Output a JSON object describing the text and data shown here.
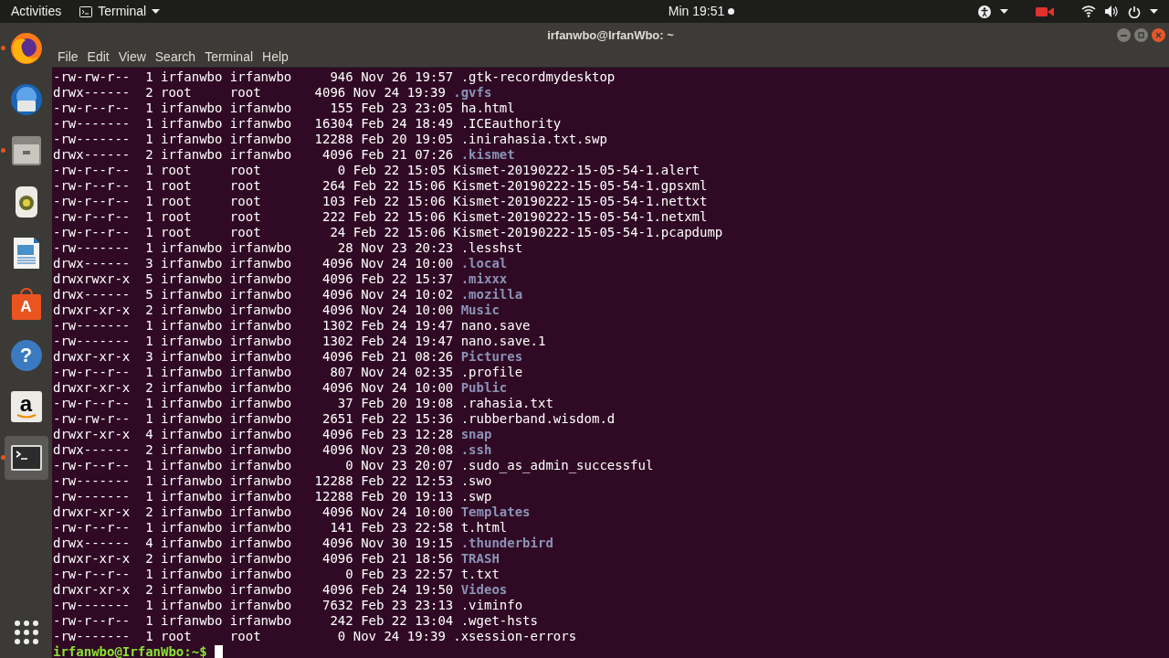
{
  "top_bar": {
    "activities": "Activities",
    "app_menu": "Terminal",
    "clock": "Min 19:51"
  },
  "dock": [
    {
      "kind": "firefox",
      "running": true,
      "selected": false
    },
    {
      "kind": "mail",
      "running": false,
      "selected": false
    },
    {
      "kind": "files",
      "running": true,
      "selected": false
    },
    {
      "kind": "speaker",
      "running": false,
      "selected": false
    },
    {
      "kind": "document",
      "running": false,
      "selected": false
    },
    {
      "kind": "software",
      "glyph": "A",
      "running": false,
      "selected": false
    },
    {
      "kind": "help",
      "glyph": "?",
      "running": false,
      "selected": false
    },
    {
      "kind": "amazon",
      "glyph": "a",
      "running": false,
      "selected": false
    },
    {
      "kind": "terminal",
      "running": true,
      "selected": true
    }
  ],
  "window": {
    "title": "irfanwbo@IrfanWbo: ~",
    "menu": [
      "File",
      "Edit",
      "View",
      "Search",
      "Terminal",
      "Help"
    ]
  },
  "terminal": {
    "rows": [
      {
        "listing": "-rw-rw-r--  1 irfanwbo irfanwbo     946 Nov 26 19:57",
        "name": ".gtk-recordmydesktop",
        "kind": "file"
      },
      {
        "listing": "drwx------  2 root     root       4096 Nov 24 19:39",
        "name": ".gvfs",
        "kind": "dir"
      },
      {
        "listing": "-rw-r--r--  1 irfanwbo irfanwbo     155 Feb 23 23:05",
        "name": "ha.html",
        "kind": "file"
      },
      {
        "listing": "-rw-------  1 irfanwbo irfanwbo   16304 Feb 24 18:49",
        "name": ".ICEauthority",
        "kind": "file"
      },
      {
        "listing": "-rw-------  1 irfanwbo irfanwbo   12288 Feb 20 19:05",
        "name": ".inirahasia.txt.swp",
        "kind": "file"
      },
      {
        "listing": "drwx------  2 irfanwbo irfanwbo    4096 Feb 21 07:26",
        "name": ".kismet",
        "kind": "dir"
      },
      {
        "listing": "-rw-r--r--  1 root     root          0 Feb 22 15:05",
        "name": "Kismet-20190222-15-05-54-1.alert",
        "kind": "file"
      },
      {
        "listing": "-rw-r--r--  1 root     root        264 Feb 22 15:06",
        "name": "Kismet-20190222-15-05-54-1.gpsxml",
        "kind": "file"
      },
      {
        "listing": "-rw-r--r--  1 root     root        103 Feb 22 15:06",
        "name": "Kismet-20190222-15-05-54-1.nettxt",
        "kind": "file"
      },
      {
        "listing": "-rw-r--r--  1 root     root        222 Feb 22 15:06",
        "name": "Kismet-20190222-15-05-54-1.netxml",
        "kind": "file"
      },
      {
        "listing": "-rw-r--r--  1 root     root         24 Feb 22 15:06",
        "name": "Kismet-20190222-15-05-54-1.pcapdump",
        "kind": "file"
      },
      {
        "listing": "-rw-------  1 irfanwbo irfanwbo      28 Nov 23 20:23",
        "name": ".lesshst",
        "kind": "file"
      },
      {
        "listing": "drwx------  3 irfanwbo irfanwbo    4096 Nov 24 10:00",
        "name": ".local",
        "kind": "dir"
      },
      {
        "listing": "drwxrwxr-x  5 irfanwbo irfanwbo    4096 Feb 22 15:37",
        "name": ".mixxx",
        "kind": "dir"
      },
      {
        "listing": "drwx------  5 irfanwbo irfanwbo    4096 Nov 24 10:02",
        "name": ".mozilla",
        "kind": "dir"
      },
      {
        "listing": "drwxr-xr-x  2 irfanwbo irfanwbo    4096 Nov 24 10:00",
        "name": "Music",
        "kind": "dir"
      },
      {
        "listing": "-rw-------  1 irfanwbo irfanwbo    1302 Feb 24 19:47",
        "name": "nano.save",
        "kind": "file"
      },
      {
        "listing": "-rw-------  1 irfanwbo irfanwbo    1302 Feb 24 19:47",
        "name": "nano.save.1",
        "kind": "file"
      },
      {
        "listing": "drwxr-xr-x  3 irfanwbo irfanwbo    4096 Feb 21 08:26",
        "name": "Pictures",
        "kind": "dir"
      },
      {
        "listing": "-rw-r--r--  1 irfanwbo irfanwbo     807 Nov 24 02:35",
        "name": ".profile",
        "kind": "file"
      },
      {
        "listing": "drwxr-xr-x  2 irfanwbo irfanwbo    4096 Nov 24 10:00",
        "name": "Public",
        "kind": "dir"
      },
      {
        "listing": "-rw-r--r--  1 irfanwbo irfanwbo      37 Feb 20 19:08",
        "name": ".rahasia.txt",
        "kind": "file"
      },
      {
        "listing": "-rw-rw-r--  1 irfanwbo irfanwbo    2651 Feb 22 15:36",
        "name": ".rubberband.wisdom.d",
        "kind": "file"
      },
      {
        "listing": "drwxr-xr-x  4 irfanwbo irfanwbo    4096 Feb 23 12:28",
        "name": "snap",
        "kind": "dir"
      },
      {
        "listing": "drwx------  2 irfanwbo irfanwbo    4096 Nov 23 20:08",
        "name": ".ssh",
        "kind": "dir"
      },
      {
        "listing": "-rw-r--r--  1 irfanwbo irfanwbo       0 Nov 23 20:07",
        "name": ".sudo_as_admin_successful",
        "kind": "file"
      },
      {
        "listing": "-rw-------  1 irfanwbo irfanwbo   12288 Feb 22 12:53",
        "name": ".swo",
        "kind": "file"
      },
      {
        "listing": "-rw-------  1 irfanwbo irfanwbo   12288 Feb 20 19:13",
        "name": ".swp",
        "kind": "file"
      },
      {
        "listing": "drwxr-xr-x  2 irfanwbo irfanwbo    4096 Nov 24 10:00",
        "name": "Templates",
        "kind": "dir"
      },
      {
        "listing": "-rw-r--r--  1 irfanwbo irfanwbo     141 Feb 23 22:58",
        "name": "t.html",
        "kind": "file"
      },
      {
        "listing": "drwx------  4 irfanwbo irfanwbo    4096 Nov 30 19:15",
        "name": ".thunderbird",
        "kind": "dir"
      },
      {
        "listing": "drwxr-xr-x  2 irfanwbo irfanwbo    4096 Feb 21 18:56",
        "name": "TRASH",
        "kind": "dir"
      },
      {
        "listing": "-rw-r--r--  1 irfanwbo irfanwbo       0 Feb 23 22:57",
        "name": "t.txt",
        "kind": "file"
      },
      {
        "listing": "drwxr-xr-x  2 irfanwbo irfanwbo    4096 Feb 24 19:50",
        "name": "Videos",
        "kind": "dir"
      },
      {
        "listing": "-rw-------  1 irfanwbo irfanwbo    7632 Feb 23 23:13",
        "name": ".viminfo",
        "kind": "file"
      },
      {
        "listing": "-rw-r--r--  1 irfanwbo irfanwbo     242 Feb 22 13:04",
        "name": ".wget-hsts",
        "kind": "file"
      },
      {
        "listing": "-rw-------  1 root     root          0 Nov 24 19:39",
        "name": ".xsession-errors",
        "kind": "file"
      }
    ],
    "prompt": "irfanwbo@IrfanWbo:~$"
  }
}
